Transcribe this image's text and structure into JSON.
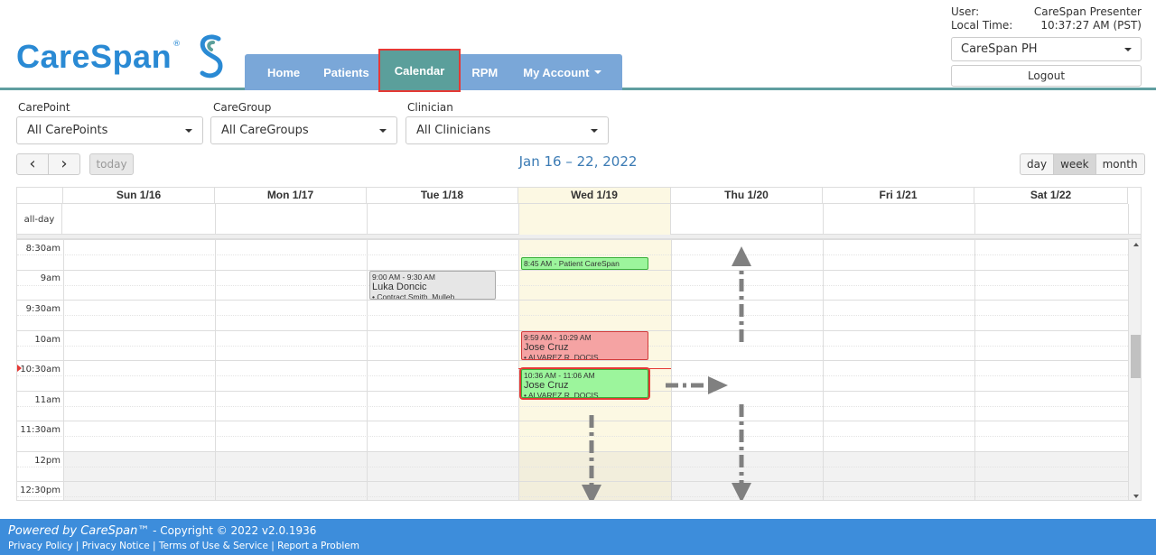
{
  "header": {
    "logo_text": "CareSpan",
    "logo_reg": "®",
    "nav": [
      "Home",
      "Patients",
      "Calendar",
      "RPM",
      "My Account"
    ]
  },
  "user": {
    "user_label": "User:",
    "user_value": "CareSpan Presenter",
    "time_label": "Local Time:",
    "time_value": "10:37:27 AM (PST)",
    "org": "CareSpan PH",
    "logout": "Logout"
  },
  "filters": {
    "carepoint_label": "CarePoint",
    "carepoint_value": "All CarePoints",
    "caregroup_label": "CareGroup",
    "caregroup_value": "All CareGroups",
    "clinician_label": "Clinician",
    "clinician_value": "All Clinicians"
  },
  "toolbar": {
    "prev": "‹",
    "next": "›",
    "today": "today",
    "title": "Jan 16 – 22, 2022",
    "views": [
      "day",
      "week",
      "month"
    ],
    "active_view": "week"
  },
  "calendar": {
    "days": [
      "Sun 1/16",
      "Mon 1/17",
      "Tue 1/18",
      "Wed 1/19",
      "Thu 1/20",
      "Fri 1/21",
      "Sat 1/22"
    ],
    "allday": "all-day",
    "times": [
      "8:30am",
      "9am",
      "9:30am",
      "10am",
      "10:30am",
      "11am",
      "11:30am",
      "12pm",
      "12:30pm"
    ],
    "events": [
      {
        "time": "9:00 AM - 9:30 AM",
        "name": "Luka Doncic",
        "sub": "• Contract Smith, Mulleh"
      },
      {
        "time": "8:45 AM - Patient CareSpan",
        "name": "",
        "sub": ""
      },
      {
        "time": "9:59 AM - 10:29 AM",
        "name": "Jose Cruz",
        "sub": "• ALVAREZ R. DOCIS"
      },
      {
        "time": "10:36 AM - 11:06 AM",
        "name": "Jose Cruz",
        "sub": "• ALVAREZ R. DOCIS"
      }
    ]
  },
  "footer": {
    "powered": "Powered by CareSpan™",
    "copyright": " - Copyright © 2022 v2.0.1936",
    "links": [
      "Privacy Policy",
      "Privacy Notice",
      "Terms of Use & Service",
      "Report a Problem"
    ]
  }
}
